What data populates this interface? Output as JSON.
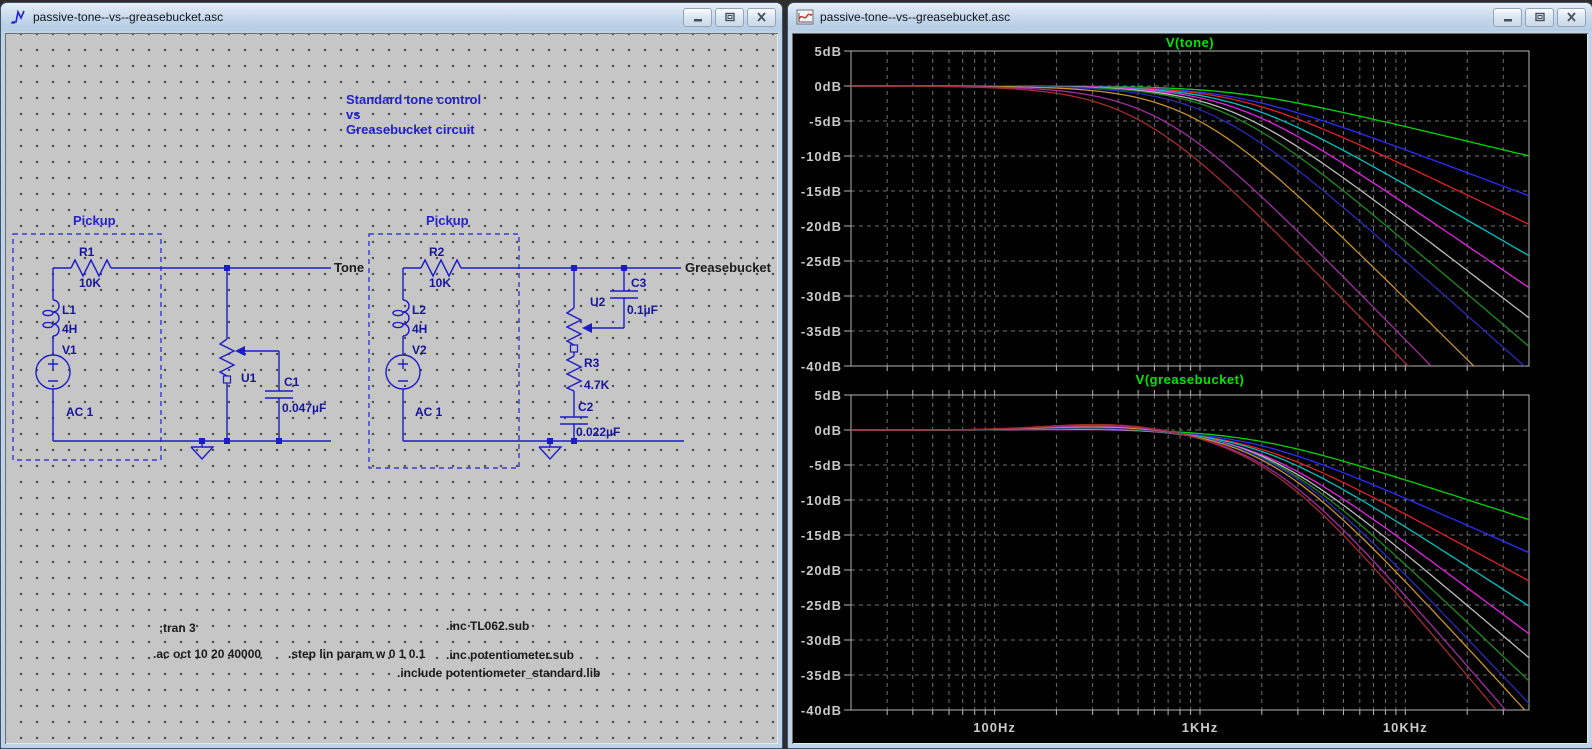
{
  "left_window": {
    "title": "passive-tone--vs--greasebucket.asc",
    "annotation": [
      "Standard tone control",
      "vs",
      "Greasebucket circuit"
    ],
    "circuit1": {
      "group_label": "Pickup",
      "net_label": "Tone",
      "r1_ref": "R1",
      "r1_val": "10K",
      "l1_ref": "L1",
      "l1_val": "4H",
      "v1_ref": "V1",
      "v1_val": "AC 1",
      "u1_ref": "U1",
      "c1_ref": "C1",
      "c1_val": "0.047µF"
    },
    "circuit2": {
      "group_label": "Pickup",
      "net_label": "Greasebucket",
      "r2_ref": "R2",
      "r2_val": "10K",
      "l2_ref": "L2",
      "l2_val": "4H",
      "v2_ref": "V2",
      "v2_val": "AC 1",
      "u2_ref": "U2",
      "c3_ref": "C3",
      "c3_val": "0.1µF",
      "r3_ref": "R3",
      "r3_val": "4.7K",
      "c2_ref": "C2",
      "c2_val": "0.022µF"
    },
    "directives": [
      ";tran 3",
      ".ac oct 10 20 40000",
      ".step lin param w 0 1 0.1",
      ".inc TL062.sub",
      ".inc potentiometer.sub",
      ".include potentiometer_standard.lib"
    ]
  },
  "right_window": {
    "title": "passive-tone--vs--greasebucket.asc"
  },
  "chart_data": [
    {
      "type": "line",
      "title": "V(tone)",
      "title_color": "#00e600",
      "x_scale": "log",
      "x_range_hz": [
        20,
        40000
      ],
      "y_range_db": [
        -40,
        5
      ],
      "grid": true,
      "y_tick_labels": [
        "5dB",
        "0dB",
        "-5dB",
        "-10dB",
        "-15dB",
        "-20dB",
        "-25dB",
        "-30dB",
        "-35dB",
        "-40dB"
      ],
      "x_tick_labels": [
        "100Hz",
        "1KHz",
        "10KHz"
      ],
      "x_tick_hz": [
        100,
        1000,
        10000
      ],
      "bump_center_hz": 380,
      "bump_sigma_decades": 0.32,
      "series": [
        {
          "run": 1,
          "color": "#00d600",
          "fc": 1500,
          "slope": 7,
          "bump": 0
        },
        {
          "run": 2,
          "color": "#2d2dff",
          "fc": 1500,
          "slope": 11,
          "bump": 0
        },
        {
          "run": 3,
          "color": "#e02222",
          "fc": 1550,
          "slope": 14,
          "bump": 0
        },
        {
          "run": 4,
          "color": "#00c3c3",
          "fc": 1500,
          "slope": 17,
          "bump": 0
        },
        {
          "run": 5,
          "color": "#e522e5",
          "fc": 1450,
          "slope": 20,
          "bump": 0
        },
        {
          "run": 6,
          "color": "#bdbdbd",
          "fc": 1350,
          "slope": 22.5,
          "bump": 0
        },
        {
          "run": 7,
          "color": "#1e8c1e",
          "fc": 1300,
          "slope": 25,
          "bump": 0
        },
        {
          "run": 8,
          "color": "#2a2ab4",
          "fc": 1100,
          "slope": 26,
          "bump": 0
        },
        {
          "run": 9,
          "color": "#c8912d",
          "fc": 900,
          "slope": 29,
          "bump": 0
        },
        {
          "run": 10,
          "color": "#a32da3",
          "fc": 620,
          "slope": 30,
          "bump": 0
        },
        {
          "run": 11,
          "color": "#a32d2d",
          "fc": 480,
          "slope": 30,
          "bump": 0
        }
      ]
    },
    {
      "type": "line",
      "title": "V(greasebucket)",
      "title_color": "#00e600",
      "x_scale": "log",
      "x_range_hz": [
        20,
        40000
      ],
      "y_range_db": [
        -40,
        5
      ],
      "grid": true,
      "y_tick_labels": [
        "5dB",
        "0dB",
        "-5dB",
        "-10dB",
        "-15dB",
        "-20dB",
        "-25dB",
        "-30dB",
        "-35dB",
        "-40dB"
      ],
      "x_tick_labels": [
        "100Hz",
        "1KHz",
        "10KHz"
      ],
      "x_tick_hz": [
        100,
        1000,
        10000
      ],
      "bump_center_hz": 380,
      "bump_sigma_decades": 0.32,
      "series": [
        {
          "run": 1,
          "color": "#00d600",
          "fc": 1800,
          "slope": 9.5,
          "bump": 0.1
        },
        {
          "run": 2,
          "color": "#2d2dff",
          "fc": 1800,
          "slope": 13,
          "bump": 0.1
        },
        {
          "run": 3,
          "color": "#e02222",
          "fc": 1800,
          "slope": 16,
          "bump": 0.15
        },
        {
          "run": 4,
          "color": "#00c3c3",
          "fc": 1900,
          "slope": 19,
          "bump": 0.2
        },
        {
          "run": 5,
          "color": "#e522e5",
          "fc": 1900,
          "slope": 22,
          "bump": 0.25
        },
        {
          "run": 6,
          "color": "#bdbdbd",
          "fc": 2000,
          "slope": 25,
          "bump": 0.3
        },
        {
          "run": 7,
          "color": "#1e8c1e",
          "fc": 2100,
          "slope": 28,
          "bump": 0.35
        },
        {
          "run": 8,
          "color": "#2a2ab4",
          "fc": 2200,
          "slope": 31,
          "bump": 0.45
        },
        {
          "run": 9,
          "color": "#c8912d",
          "fc": 2150,
          "slope": 32,
          "bump": 0.6
        },
        {
          "run": 10,
          "color": "#a32da3",
          "fc": 2050,
          "slope": 34,
          "bump": 0.8
        },
        {
          "run": 11,
          "color": "#a32d2d",
          "fc": 2000,
          "slope": 35,
          "bump": 1.0
        }
      ]
    }
  ]
}
